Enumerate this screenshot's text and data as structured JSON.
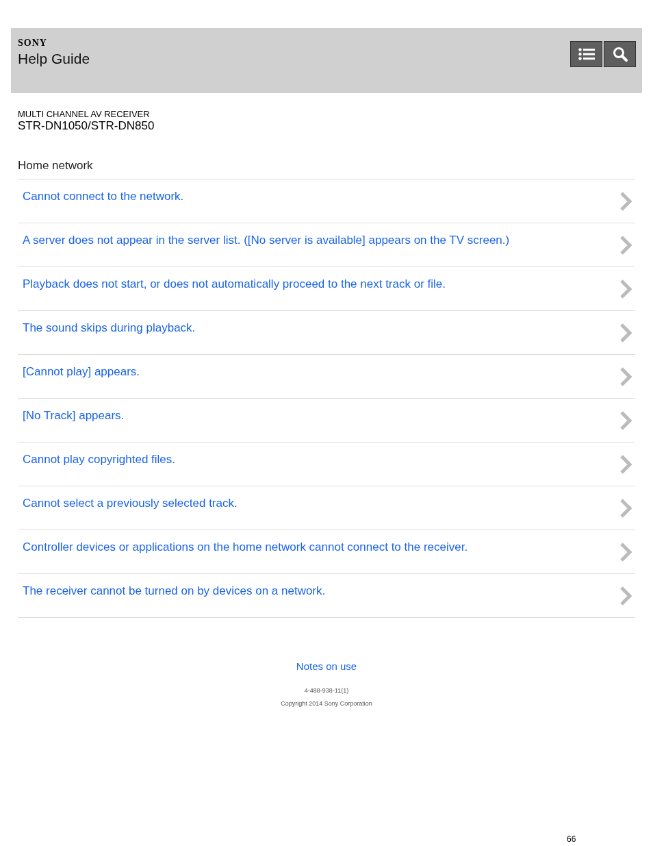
{
  "header": {
    "brand": "SONY",
    "title": "Help Guide"
  },
  "product": {
    "category": "MULTI CHANNEL AV RECEIVER",
    "model": "STR-DN1050/STR-DN850"
  },
  "section": {
    "title": "Home network",
    "items": [
      "Cannot connect to the network.",
      "A server does not appear in the server list. ([No server is available] appears on the TV screen.)",
      "Playback does not start, or does not automatically proceed to the next track or file.",
      "The sound skips during playback.",
      "[Cannot play] appears.",
      "[No Track] appears.",
      "Cannot play copyrighted files.",
      "Cannot select a previously selected track.",
      "Controller devices or applications on the home network cannot connect to the receiver.",
      "The receiver cannot be turned on by devices on a network."
    ]
  },
  "footer": {
    "link": "Notes on use",
    "code": "4-488-938-11(1)",
    "copyright": "Copyright 2014 Sony Corporation"
  },
  "page_number": "66"
}
